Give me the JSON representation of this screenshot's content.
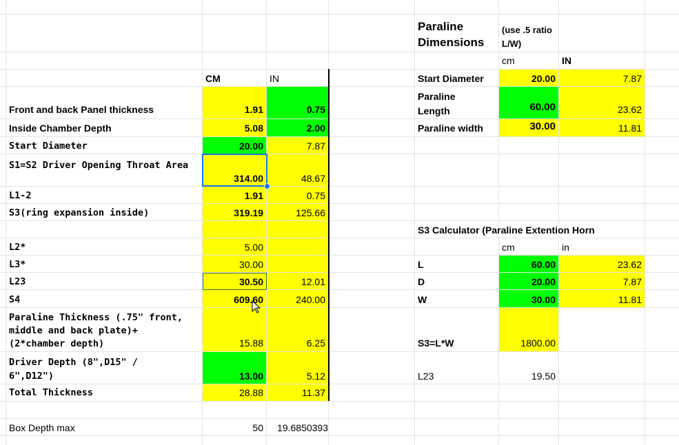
{
  "colors": {
    "yellow": "#ffff00",
    "green": "#00ff00",
    "grid": "#e2e3e3",
    "selection": "#1a73e8"
  },
  "left": {
    "header_cm": "CM",
    "header_in": "IN",
    "rows": [
      {
        "label": "Front and back Panel thickness",
        "cm": "1.91",
        "in": "0.75"
      },
      {
        "label": "Inside Chamber Depth",
        "cm": "5.08",
        "in": "2.00"
      },
      {
        "label": "Start Diameter",
        "cm": "20.00",
        "in": "7.87"
      },
      {
        "label": "S1=S2 Driver Opening Throat Area",
        "cm": "314.00",
        "in": "48.67"
      },
      {
        "label": "L1-2",
        "cm": "1.91",
        "in": "0.75"
      },
      {
        "label": "S3(ring expansion inside)",
        "cm": "319.19",
        "in": "125.66"
      },
      {
        "label": "L2*",
        "cm": "5.00",
        "in": ""
      },
      {
        "label": "L3*",
        "cm": "30.00",
        "in": ""
      },
      {
        "label": "L23",
        "cm": "30.50",
        "in": "12.01"
      },
      {
        "label": "S4",
        "cm": "609.60",
        "in": "240.00"
      },
      {
        "label": "Paraline Thickness (.75\" front, middle and back plate)+(2*chamber depth)",
        "cm": "15.88",
        "in": "6.25"
      },
      {
        "label": "Driver Depth (8\",D15\" / 6\",D12\")",
        "cm": "13.00",
        "in": "5.12"
      },
      {
        "label": "Total Thickness",
        "cm": "28.88",
        "in": "11.37"
      },
      {
        "label": "Box Depth max",
        "cm": "50",
        "in": "19.6850393"
      }
    ]
  },
  "right": {
    "title": "Paraline Dimensions",
    "note": "(use .5 ratio L/W)",
    "unit_cm": "cm",
    "unit_in": "IN",
    "rows": [
      {
        "label": "Start Diameter",
        "cm": "20.00",
        "in": "7.87"
      },
      {
        "label": "Paraline Length",
        "cm": "60.00",
        "in": "23.62"
      },
      {
        "label": "Paraline width",
        "cm": "30.00",
        "in": "11.81"
      }
    ],
    "calc_title": "S3 Calculator (Paraline  Extention Horn",
    "calc_unit_cm": "cm",
    "calc_unit_in": "in",
    "calc_rows": [
      {
        "label": "L",
        "cm": "60.00",
        "in": "23.62"
      },
      {
        "label": "D",
        "cm": "20.00",
        "in": "7.87"
      },
      {
        "label": "W",
        "cm": "30.00",
        "in": "11.81"
      }
    ],
    "s3_label": "S3=L*W",
    "s3_value": "1800.00",
    "l23_label": "L23",
    "l23_value": "19.50"
  }
}
